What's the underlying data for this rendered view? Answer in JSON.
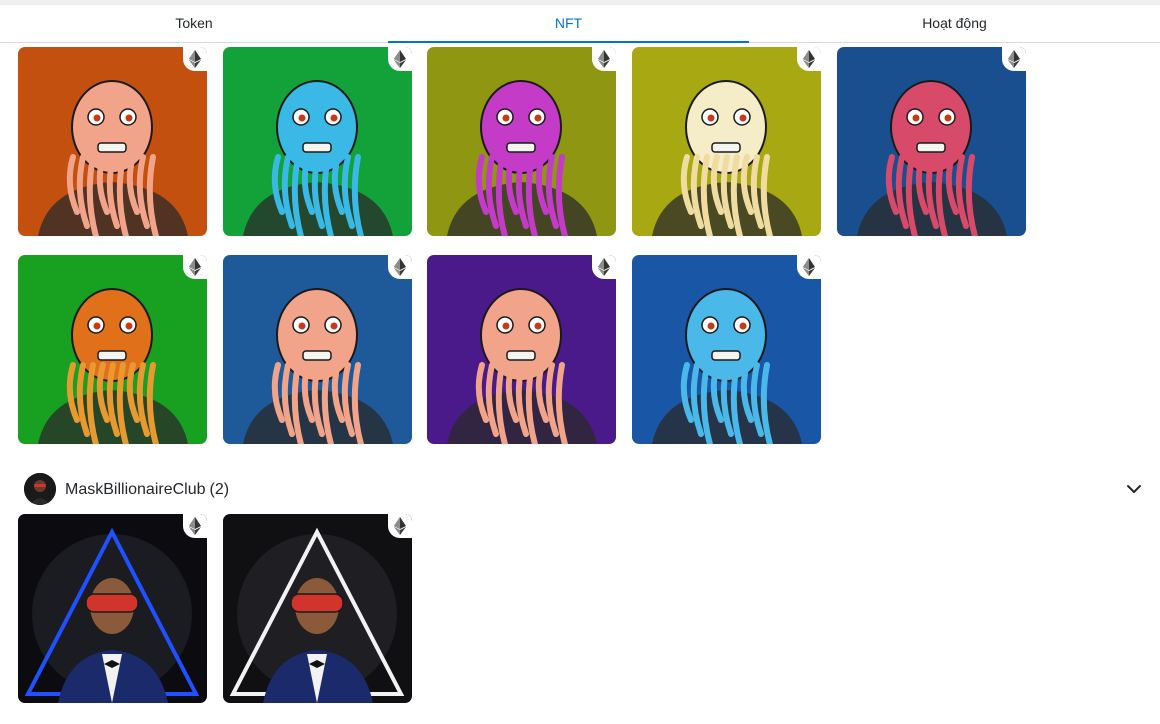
{
  "tabs": [
    {
      "label": "Token",
      "active": false
    },
    {
      "label": "NFT",
      "active": true
    },
    {
      "label": "Hoạt động",
      "active": false
    }
  ],
  "colors": {
    "accent": "#0376c9",
    "text": "#24272a",
    "divider": "#d6d9dc"
  },
  "nfts": [
    {
      "bg": "#c4500f",
      "skin": "#f2a48a",
      "beard": "#f2a48a",
      "icon": "eth-icon"
    },
    {
      "bg": "#13a23a",
      "skin": "#3ab8e6",
      "beard": "#3ab8e6",
      "icon": "eth-icon"
    },
    {
      "bg": "#8e9612",
      "skin": "#c43bc8",
      "beard": "#c43bc8",
      "icon": "eth-icon"
    },
    {
      "bg": "#a8a812",
      "skin": "#f5ecc8",
      "beard": "#f0dca0",
      "icon": "eth-icon"
    },
    {
      "bg": "#1a4f8f",
      "skin": "#d84a6a",
      "beard": "#d84a6a",
      "icon": "eth-icon"
    },
    {
      "bg": "#18a020",
      "skin": "#e0701a",
      "beard": "#e89a30",
      "icon": "eth-icon"
    },
    {
      "bg": "#1e5a99",
      "skin": "#f2a48a",
      "beard": "#f2a48a",
      "icon": "eth-icon"
    },
    {
      "bg": "#4a1a8a",
      "skin": "#f2a48a",
      "beard": "#f2a48a",
      "icon": "eth-icon"
    },
    {
      "bg": "#1a56a6",
      "skin": "#4ab8e8",
      "beard": "#4ab8e8",
      "icon": "eth-icon"
    }
  ],
  "collection": {
    "name": "MaskBillionaireClub",
    "count": "(2)",
    "items": [
      {
        "bg": "#0b0b10",
        "accent": "#2050ff",
        "icon": "eth-icon"
      },
      {
        "bg": "#101012",
        "accent": "#f2f2f2",
        "icon": "eth-icon"
      }
    ]
  }
}
